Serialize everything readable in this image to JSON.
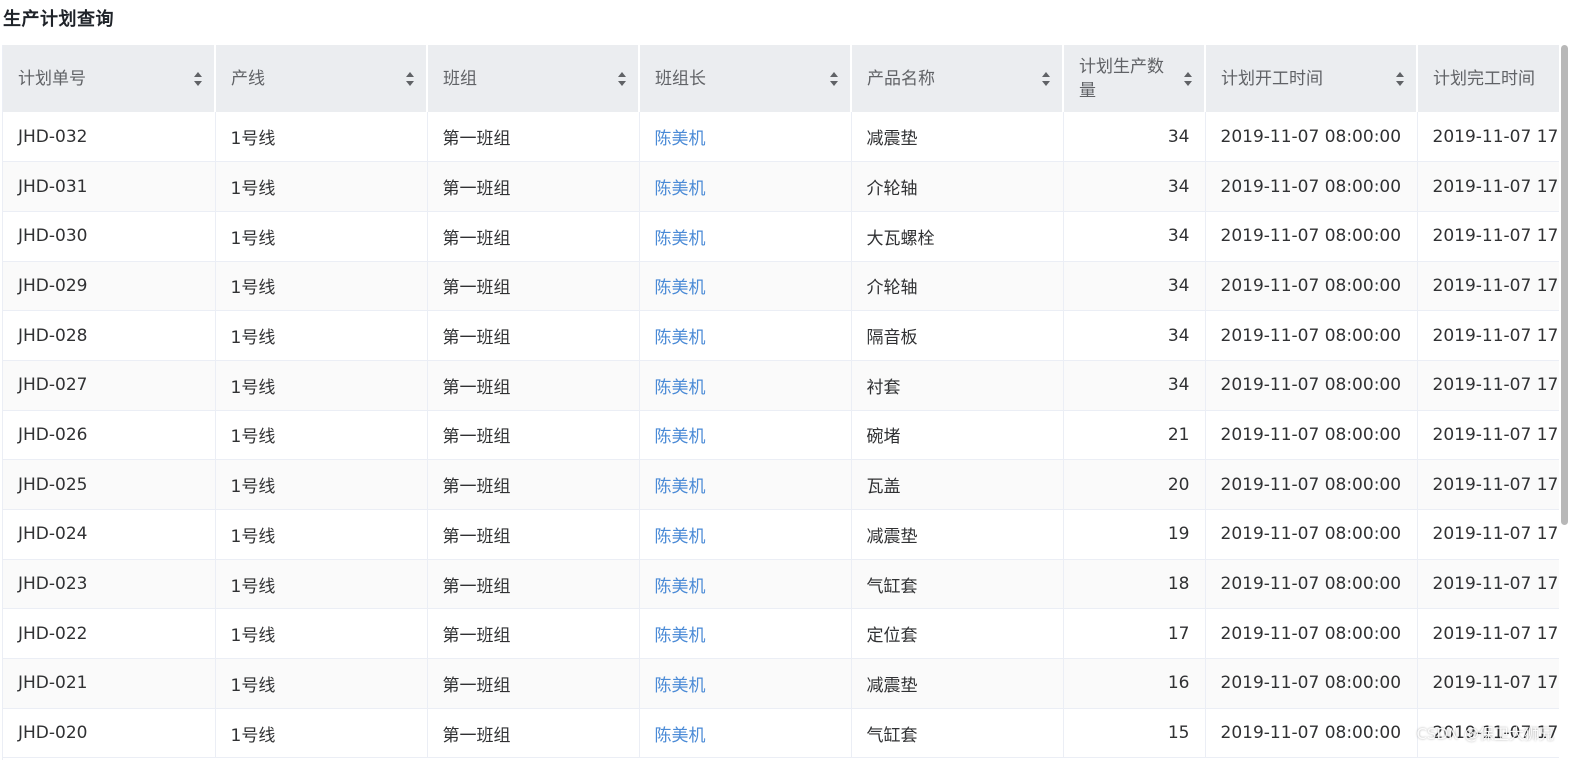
{
  "page": {
    "title": "生产计划查询",
    "watermark": "CSDN @保卫大狮兄"
  },
  "table": {
    "columns": [
      {
        "label": "计划单号",
        "sortable": true
      },
      {
        "label": "产线",
        "sortable": true
      },
      {
        "label": "班组",
        "sortable": true
      },
      {
        "label": "班组长",
        "sortable": true
      },
      {
        "label": "产品名称",
        "sortable": true
      },
      {
        "label": "计划生产数量",
        "sortable": true
      },
      {
        "label": "计划开工时间",
        "sortable": true
      },
      {
        "label": "计划完工时间",
        "sortable": false
      }
    ],
    "rows": [
      {
        "id": "JHD-032",
        "line": "1号线",
        "team": "第一班组",
        "leader": "陈美机",
        "product": "减震垫",
        "qty": "34",
        "start": "2019-11-07 08:00:00",
        "end": "2019-11-07 17:"
      },
      {
        "id": "JHD-031",
        "line": "1号线",
        "team": "第一班组",
        "leader": "陈美机",
        "product": "介轮轴",
        "qty": "34",
        "start": "2019-11-07 08:00:00",
        "end": "2019-11-07 17:"
      },
      {
        "id": "JHD-030",
        "line": "1号线",
        "team": "第一班组",
        "leader": "陈美机",
        "product": "大瓦螺栓",
        "qty": "34",
        "start": "2019-11-07 08:00:00",
        "end": "2019-11-07 17:"
      },
      {
        "id": "JHD-029",
        "line": "1号线",
        "team": "第一班组",
        "leader": "陈美机",
        "product": "介轮轴",
        "qty": "34",
        "start": "2019-11-07 08:00:00",
        "end": "2019-11-07 17:"
      },
      {
        "id": "JHD-028",
        "line": "1号线",
        "team": "第一班组",
        "leader": "陈美机",
        "product": "隔音板",
        "qty": "34",
        "start": "2019-11-07 08:00:00",
        "end": "2019-11-07 17:"
      },
      {
        "id": "JHD-027",
        "line": "1号线",
        "team": "第一班组",
        "leader": "陈美机",
        "product": "衬套",
        "qty": "34",
        "start": "2019-11-07 08:00:00",
        "end": "2019-11-07 17:"
      },
      {
        "id": "JHD-026",
        "line": "1号线",
        "team": "第一班组",
        "leader": "陈美机",
        "product": "碗堵",
        "qty": "21",
        "start": "2019-11-07 08:00:00",
        "end": "2019-11-07 17:"
      },
      {
        "id": "JHD-025",
        "line": "1号线",
        "team": "第一班组",
        "leader": "陈美机",
        "product": "瓦盖",
        "qty": "20",
        "start": "2019-11-07 08:00:00",
        "end": "2019-11-07 17:"
      },
      {
        "id": "JHD-024",
        "line": "1号线",
        "team": "第一班组",
        "leader": "陈美机",
        "product": "减震垫",
        "qty": "19",
        "start": "2019-11-07 08:00:00",
        "end": "2019-11-07 17:"
      },
      {
        "id": "JHD-023",
        "line": "1号线",
        "team": "第一班组",
        "leader": "陈美机",
        "product": "气缸套",
        "qty": "18",
        "start": "2019-11-07 08:00:00",
        "end": "2019-11-07 17:"
      },
      {
        "id": "JHD-022",
        "line": "1号线",
        "team": "第一班组",
        "leader": "陈美机",
        "product": "定位套",
        "qty": "17",
        "start": "2019-11-07 08:00:00",
        "end": "2019-11-07 17:"
      },
      {
        "id": "JHD-021",
        "line": "1号线",
        "team": "第一班组",
        "leader": "陈美机",
        "product": "减震垫",
        "qty": "16",
        "start": "2019-11-07 08:00:00",
        "end": "2019-11-07 17:"
      },
      {
        "id": "JHD-020",
        "line": "1号线",
        "team": "第一班组",
        "leader": "陈美机",
        "product": "气缸套",
        "qty": "15",
        "start": "2019-11-07 08:00:00",
        "end": "2019-11-07 17:"
      }
    ]
  },
  "colors": {
    "header_bg": "#ebedf0",
    "link": "#4a8ad6",
    "stripe": "#fafafa"
  }
}
